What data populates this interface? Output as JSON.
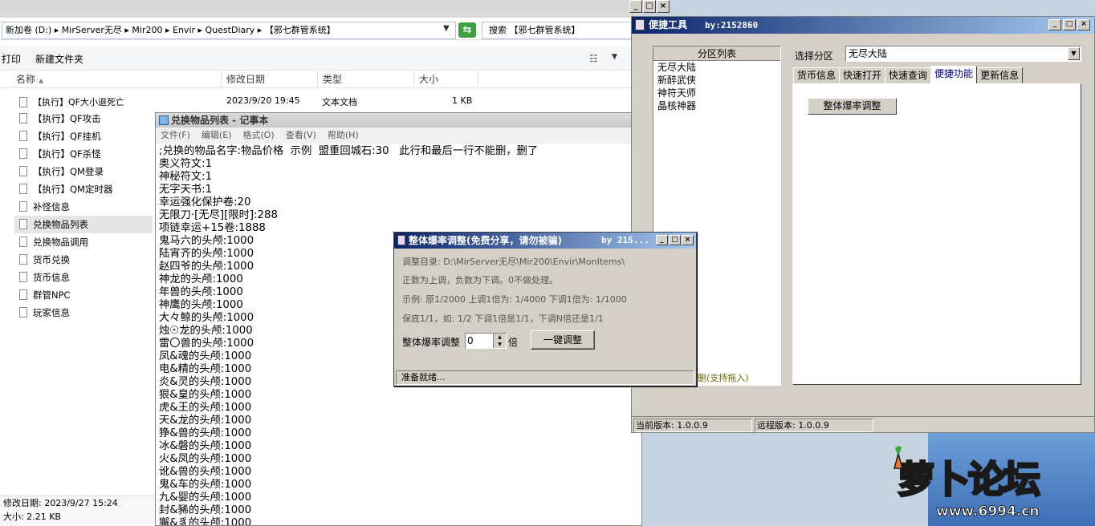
{
  "explorer": {
    "address": "新加卷 (D:) ▸ MirServer无尽 ▸ Mir200 ▸ Envir ▸ QuestDiary ▸ 【邪七群管系统】",
    "search_placeholder": "搜索 【邪七群管系统】",
    "toolbar": {
      "print": "打印",
      "new_folder": "新建文件夹"
    },
    "columns": {
      "name": "名称",
      "modified": "修改日期",
      "type": "类型",
      "size": "大小"
    },
    "first_row": {
      "name": "【执行】QF大小退死亡",
      "modified": "2023/9/20 19:45",
      "type": "文本文档",
      "size": "1 KB"
    },
    "files": [
      {
        "name": "【执行】QF攻击"
      },
      {
        "name": "【执行】QF挂机"
      },
      {
        "name": "【执行】QF杀怪"
      },
      {
        "name": "【执行】QM登录"
      },
      {
        "name": "【执行】QM定时器"
      },
      {
        "name": "补怪信息"
      },
      {
        "name": "兑换物品列表",
        "selected": true
      },
      {
        "name": "兑换物品调用"
      },
      {
        "name": "货币兑换"
      },
      {
        "name": "货币信息"
      },
      {
        "name": "群管NPC"
      },
      {
        "name": "玩家信息"
      }
    ],
    "status": {
      "modified": "修改日期: 2023/9/27 15:24",
      "size": "大小: 2.21 KB"
    }
  },
  "notepad": {
    "title": "兑换物品列表 - 记事本",
    "menu": [
      "文件(F)",
      "编辑(E)",
      "格式(O)",
      "查看(V)",
      "帮助(H)"
    ],
    "content": ";兑换的物品名字:物品价格  示例  盟重回城石:30   此行和最后一行不能删，删了\n奥义符文:1\n神秘符文:1\n无字天书:1\n幸运强化保护卷:20\n无限刀·[无尽][限时]:288\n项链幸运+15卷:1888\n鬼马六的头颅:1000\n陆宵齐的头颅:1000\n赵四爷的头颅:1000\n神龙的头颅:1000\n年兽的头颅:1000\n神鹰的头颅:1000\n大々鲸的头颅:1000\n烛☉龙的头颅:1000\n雷〇兽的头颅:1000\n凤&魂的头颅:1000\n电&精的头颅:1000\n炎&灵的头颅:1000\n狠&皇的头颅:1000\n虎&王的头颅:1000\n天&龙的头颅:1000\n狰&兽的头颅:1000\n冰&磐的头颅:1000\n火&凤的头颅:1000\n讹&兽的头颅:1000\n鬼&车的头颅:1000\n九&婴的头颅:1000\n封&豨的头颅:1000\n獬&豸的头颅:1000"
  },
  "shortcut": {
    "title": "便捷工具",
    "by": "by:2152860",
    "region_list": {
      "header": "分区列表",
      "items": [
        "无尽大陆",
        "新醉武侠",
        "神符天师",
        "晶核神器"
      ],
      "footer": "删(支持拖入)"
    },
    "select_label": "选择分区",
    "select_value": "无尽大陆",
    "tabs": [
      "货币信息",
      "快速打开",
      "快速查询",
      "便捷功能",
      "更新信息"
    ],
    "active_tab": "便捷功能",
    "panel_button": "整体爆率调整",
    "status": {
      "current": "当前版本: 1.0.0.9",
      "remote": "远程版本: 1.0.0.9"
    }
  },
  "dialog": {
    "title": "整体爆率调整(免费分享，请勿被骗)",
    "by": "by 215...",
    "dir": "调整目录: D:\\MirServer无尽\\Mir200\\Envir\\MonItems\\",
    "hint1": "正数为上调，负数为下调。0不做处理。",
    "hint2": "示例: 原1/2000 上调1倍为: 1/4000 下调1倍为: 1/1000",
    "hint3": "保底1/1，如: 1/2 下调1倍是1/1，下调N倍还是1/1",
    "label": "整体爆率调整",
    "value": "0",
    "unit": "倍",
    "button": "一键调整",
    "status": "准备就绪..."
  },
  "watermark": {
    "logo": "萝卜论坛",
    "url": "www.6994.cn"
  }
}
